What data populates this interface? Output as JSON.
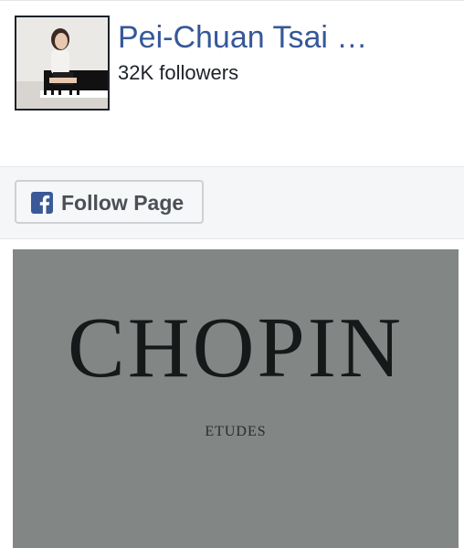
{
  "page": {
    "name": "Pei-Chuan Tsai …",
    "followers": "32K followers"
  },
  "actions": {
    "follow_label": "Follow Page",
    "follow_icon": "facebook-icon"
  },
  "cover": {
    "title": "CHOPIN",
    "subtitle": "ETUDES"
  },
  "colors": {
    "link": "#365899",
    "text": "#1d2129",
    "facebook_blue": "#3b5998",
    "button_text": "#4b4f56"
  }
}
